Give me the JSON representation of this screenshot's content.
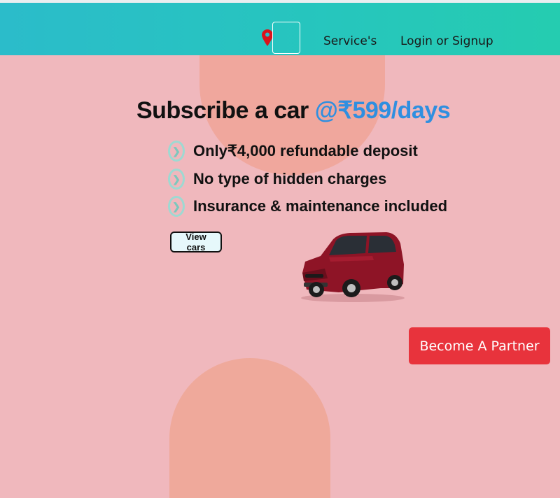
{
  "nav": {
    "location_icon": "map-pin-icon",
    "services_label": "Service's",
    "login_label": "Login or Signup"
  },
  "hero": {
    "headline_prefix": "Subscribe a car ",
    "headline_accent": "@₹599/days",
    "features": [
      "Only₹4,000 refundable deposit",
      "No type of hidden charges",
      "Insurance & maintenance included"
    ],
    "feature_icon": "chevron-right-circle-icon",
    "cta_label": "View cars",
    "car_image": "red-suv-image"
  },
  "partner_button_label": "Become A Partner",
  "colors": {
    "topbar_start": "#2bbcca",
    "topbar_end": "#25ccb0",
    "page_bg": "#f0b8bd",
    "accent_blue": "#2f8fe0",
    "partner_red": "#e8333c",
    "pin_red": "#d9141c"
  }
}
